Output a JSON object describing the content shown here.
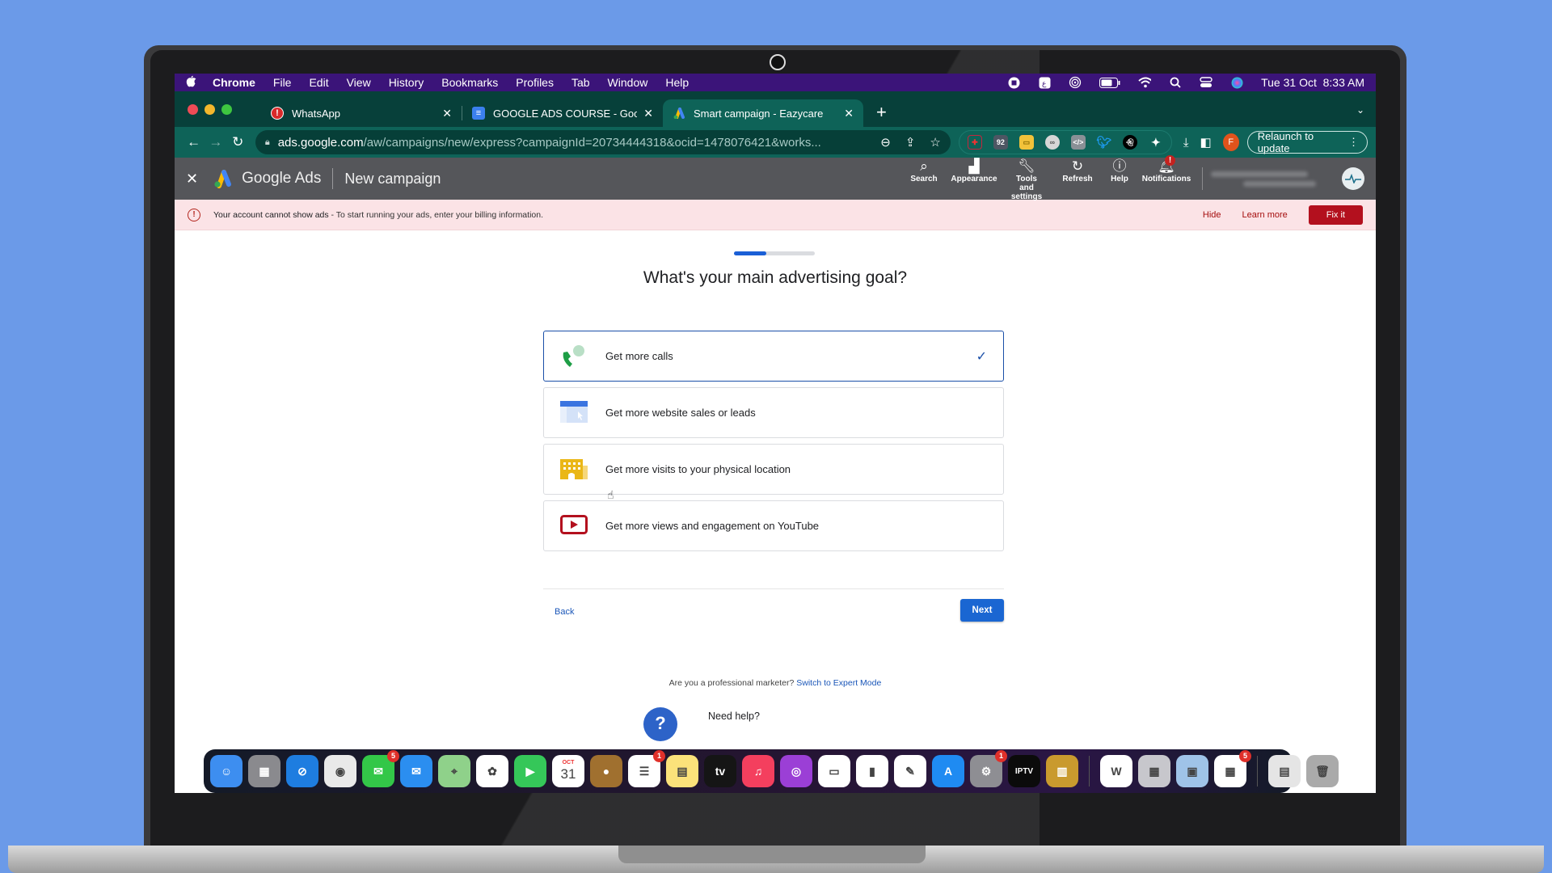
{
  "menubar": {
    "app": "Chrome",
    "items": [
      "File",
      "Edit",
      "View",
      "History",
      "Bookmarks",
      "Profiles",
      "Tab",
      "Window",
      "Help"
    ],
    "datetime": "Tue 31 Oct  8:33 AM",
    "status_icons": [
      "stop-recording-icon",
      "keyboard-input-icon",
      "airdrop-icon",
      "battery-icon",
      "wifi-icon",
      "spotlight-search-icon",
      "control-center-icon",
      "siri-icon"
    ]
  },
  "tabs": [
    {
      "title": "WhatsApp",
      "icon": "whatsapp-alert-icon"
    },
    {
      "title": "GOOGLE ADS COURSE - Google Docs",
      "icon": "google-docs-icon"
    },
    {
      "title": "Smart campaign - Eazycare",
      "icon": "google-ads-icon",
      "active": true
    }
  ],
  "address_bar": {
    "host": "ads.google.com",
    "path": "/aw/campaigns/new/express?campaignId=20734444318&ocid=1478076421&works...",
    "relaunch_label": "Relaunch to update",
    "profile_initial": "F",
    "extensions": [
      "ext-red-cross",
      "ext-92",
      "ext-tag",
      "ext-link",
      "ext-code",
      "ext-twitter",
      "ext-snapchat"
    ]
  },
  "ads_header": {
    "brand": "Google Ads",
    "page_title": "New campaign",
    "tools": [
      {
        "label": "Search",
        "icon": "search-icon"
      },
      {
        "label": "Appearance",
        "icon": "appearance-icon"
      },
      {
        "label": "Tools and settings",
        "icon": "wrench-icon"
      },
      {
        "label": "Refresh",
        "icon": "refresh-icon"
      },
      {
        "label": "Help",
        "icon": "help-icon"
      },
      {
        "label": "Notifications",
        "icon": "bell-icon",
        "badge": "!"
      }
    ]
  },
  "banner": {
    "strong": "Your account cannot show ads",
    "text": " - To start running your ads, enter your billing information.",
    "hide": "Hide",
    "learn_more": "Learn more",
    "fix_it": "Fix it"
  },
  "wizard": {
    "progress": 0.4,
    "question": "What's your main advertising goal?",
    "options": [
      {
        "label": "Get more calls",
        "icon": "phone-call-icon",
        "selected": true
      },
      {
        "label": "Get more website sales or leads",
        "icon": "website-icon",
        "selected": false
      },
      {
        "label": "Get more visits to your physical location",
        "icon": "storefront-icon",
        "selected": false
      },
      {
        "label": "Get more views and engagement on YouTube",
        "icon": "youtube-play-icon",
        "selected": false
      }
    ],
    "back": "Back",
    "next": "Next",
    "pro_prompt": "Are you a professional marketer?",
    "expert_link": "Switch to Expert Mode",
    "need_help": "Need help?",
    "help_fab": "?"
  },
  "dock": {
    "items": [
      {
        "name": "finder",
        "glyph": "☺",
        "bg": "#3d8ef0"
      },
      {
        "name": "launchpad",
        "glyph": "▦",
        "bg": "#8a8a8e"
      },
      {
        "name": "safari",
        "glyph": "⊘",
        "bg": "#1e7de0"
      },
      {
        "name": "chrome",
        "glyph": "◉",
        "bg": "#e9e9e9"
      },
      {
        "name": "messages",
        "glyph": "✉",
        "bg": "#33c748",
        "badge": "5"
      },
      {
        "name": "mail",
        "glyph": "✉",
        "bg": "#2b8ef0"
      },
      {
        "name": "maps",
        "glyph": "⌖",
        "bg": "#8fd18a"
      },
      {
        "name": "photos",
        "glyph": "✿",
        "bg": "#ffffff"
      },
      {
        "name": "facetime",
        "glyph": "▶",
        "bg": "#35c759"
      },
      {
        "name": "calendar",
        "glyph": "31",
        "bg": "#ffffff",
        "sub": "OCT"
      },
      {
        "name": "contacts",
        "glyph": "●",
        "bg": "#a0702f"
      },
      {
        "name": "reminders",
        "glyph": "☰",
        "bg": "#ffffff",
        "badge": "1"
      },
      {
        "name": "notes",
        "glyph": "▤",
        "bg": "#fbe27a"
      },
      {
        "name": "apple-tv",
        "glyph": "tv",
        "bg": "#151515"
      },
      {
        "name": "music",
        "glyph": "♫",
        "bg": "#f43f5e"
      },
      {
        "name": "podcasts",
        "glyph": "◎",
        "bg": "#9b3fd6"
      },
      {
        "name": "keynote",
        "glyph": "▭",
        "bg": "#ffffff"
      },
      {
        "name": "numbers",
        "glyph": "▮",
        "bg": "#ffffff"
      },
      {
        "name": "pages",
        "glyph": "✎",
        "bg": "#ffffff"
      },
      {
        "name": "app-store",
        "glyph": "A",
        "bg": "#1f8bf2"
      },
      {
        "name": "system-settings",
        "glyph": "⚙",
        "bg": "#8e8e93",
        "badge": "1"
      },
      {
        "name": "iptv",
        "glyph": "IPTV",
        "bg": "#0b0b0b"
      },
      {
        "name": "archive-utility",
        "glyph": "▥",
        "bg": "#c99a2e"
      },
      {
        "sep": true
      },
      {
        "name": "microsoft-word",
        "glyph": "W",
        "bg": "#ffffff"
      },
      {
        "name": "calculator",
        "glyph": "▦",
        "bg": "#c7c7cc"
      },
      {
        "name": "preview",
        "glyph": "▣",
        "bg": "#9fc3e8"
      },
      {
        "name": "microsoft-autoupdate",
        "glyph": "▦",
        "bg": "#ffffff",
        "badge": "5"
      },
      {
        "sep": true
      },
      {
        "name": "downloads-stack",
        "glyph": "▤",
        "bg": "#e5e5e5"
      },
      {
        "name": "trash",
        "glyph": "🗑",
        "bg": "#aaaaaa"
      }
    ]
  },
  "colors": {
    "menubar": "#3b1479",
    "tabbar": "#07403a",
    "toolbar": "#0e6358",
    "ads_header": "#55565a",
    "banner_bg": "#fbe3e6",
    "fix_it": "#b3101e",
    "accent_blue": "#1a66d2"
  }
}
